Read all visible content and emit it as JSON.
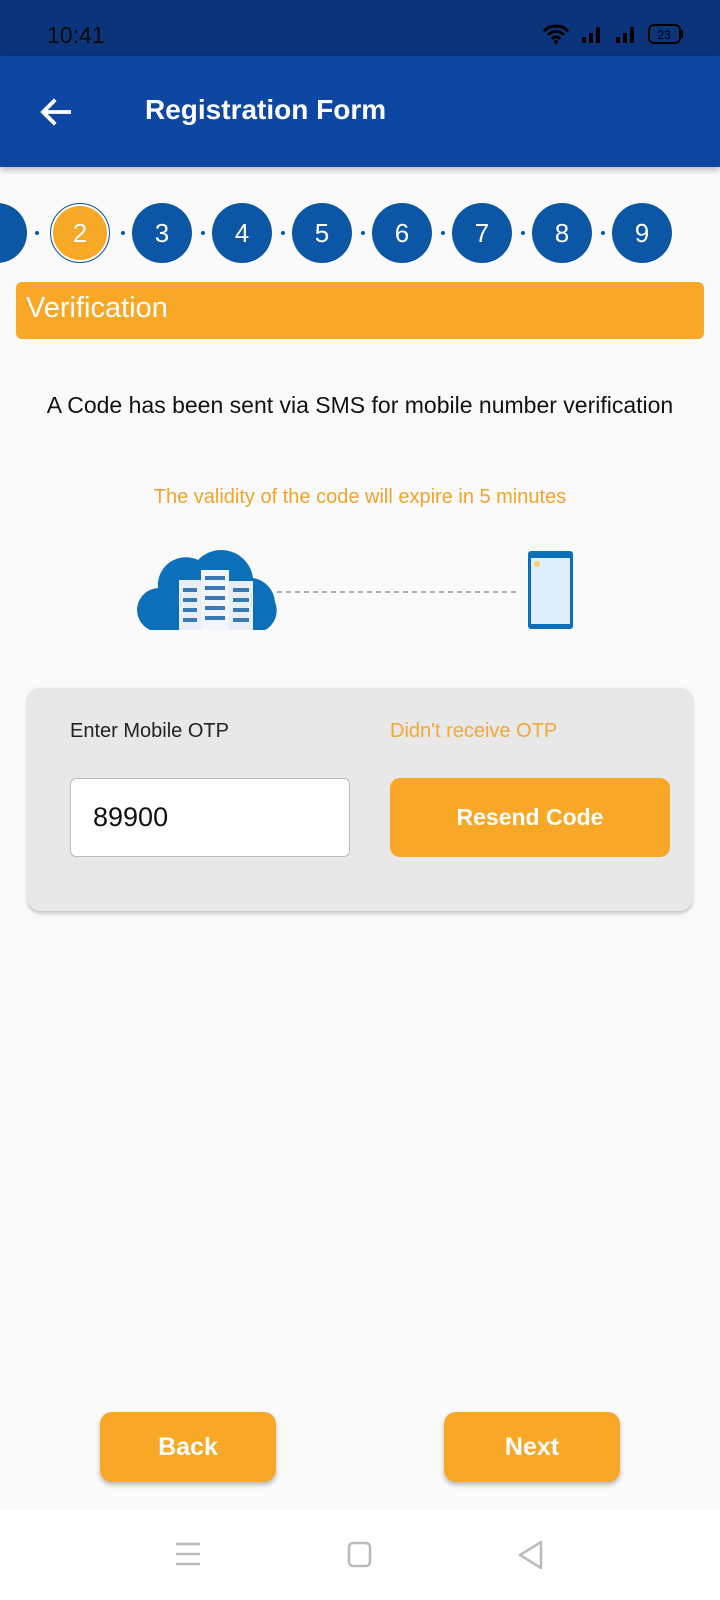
{
  "status_bar": {
    "time": "10:41",
    "battery": "23"
  },
  "app_bar": {
    "title": "Registration Form",
    "back_icon": "arrow-left-icon"
  },
  "stepper": {
    "steps": [
      "2",
      "3",
      "4",
      "5",
      "6",
      "7",
      "8",
      "9"
    ],
    "active": "2",
    "active_color": "#f7a824",
    "inactive_color": "#0b57a6"
  },
  "section": {
    "title": "Verification"
  },
  "message": "A Code has been sent via SMS for mobile number verification",
  "validity": "The validity of the code will expire in 5 minutes",
  "otp_card": {
    "label": "Enter Mobile OTP",
    "didnt_receive": "Didn't receive OTP",
    "otp_value": "89900",
    "resend_label": "Resend Code"
  },
  "footer": {
    "back_label": "Back",
    "next_label": "Next"
  },
  "colors": {
    "primary": "#0d47a1",
    "accent": "#f8a826"
  }
}
